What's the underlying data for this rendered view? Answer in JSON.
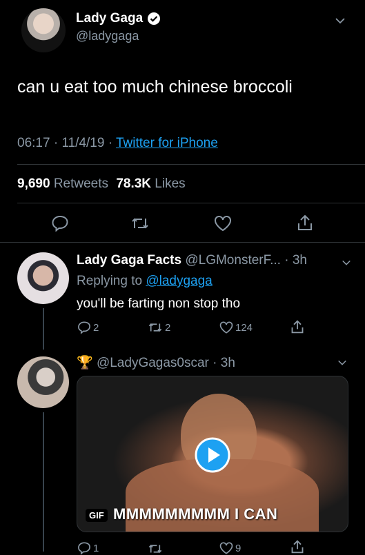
{
  "main_tweet": {
    "name": "Lady Gaga",
    "handle": "@ladygaga",
    "text": "can u eat too much chinese broccoli",
    "time": "06:17",
    "date": "11/4/19",
    "source": "Twitter for iPhone",
    "retweets": "9,690",
    "retweets_label": "Retweets",
    "likes": "78.3K",
    "likes_label": "Likes"
  },
  "reply1": {
    "name": "Lady Gaga Facts",
    "handle": "@LGMonsterF...",
    "time": "3h",
    "replying_prefix": "Replying to",
    "replying_to": "@ladygaga",
    "text": "you'll be farting non stop tho",
    "reply_count": "2",
    "retweet_count": "2",
    "like_count": "124"
  },
  "reply2": {
    "emoji": "🏆",
    "handle": "@LadyGagas0scar",
    "time": "3h",
    "gif_badge": "GIF",
    "gif_caption": "MMMMMMMMM I CAN",
    "reply_count": "1",
    "like_count": "9"
  },
  "colors": {
    "accent": "#1da1f2",
    "muted": "#8b98a5",
    "divider": "#2f3336"
  }
}
